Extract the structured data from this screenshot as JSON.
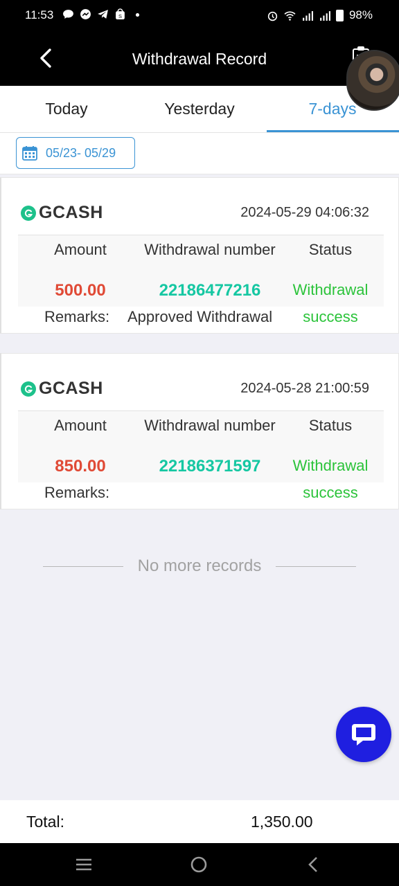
{
  "status_bar": {
    "time": "11:53",
    "battery": "98%",
    "left_icons": [
      "chat-bubble-icon",
      "messenger-icon",
      "telegram-icon",
      "shop-icon",
      "dot-icon"
    ],
    "right_icons": [
      "alarm-icon",
      "wifi-icon",
      "signal-icon",
      "signal-icon",
      "battery-icon"
    ]
  },
  "header": {
    "title": "Withdrawal Record"
  },
  "tabs": [
    {
      "label": "Today",
      "active": false
    },
    {
      "label": "Yesterday",
      "active": false
    },
    {
      "label": "7-days",
      "active": true
    }
  ],
  "filter": {
    "date_range": "05/23- 05/29"
  },
  "records": [
    {
      "provider": "GCASH",
      "datetime": "2024-05-29 04:06:32",
      "amount_header": "Amount",
      "number_header": "Withdrawal number",
      "status_header": "Status",
      "amount": "500.00",
      "number": "22186477216",
      "status_line1": "Withdrawal",
      "status_line2": "success",
      "remarks_label": "Remarks:",
      "remarks_value": "Approved Withdrawal"
    },
    {
      "provider": "GCASH",
      "datetime": "2024-05-28 21:00:59",
      "amount_header": "Amount",
      "number_header": "Withdrawal number",
      "status_header": "Status",
      "amount": "850.00",
      "number": "22186371597",
      "status_line1": "Withdrawal",
      "status_line2": "success",
      "remarks_label": "Remarks:",
      "remarks_value": ""
    }
  ],
  "no_more_text": "No more records",
  "total": {
    "label": "Total:",
    "value": "1,350.00"
  },
  "colors": {
    "accent": "#3a93d4",
    "amount": "#e04a36",
    "number": "#15c7a2",
    "status": "#2bc33a",
    "fab": "#1f1fe0"
  }
}
